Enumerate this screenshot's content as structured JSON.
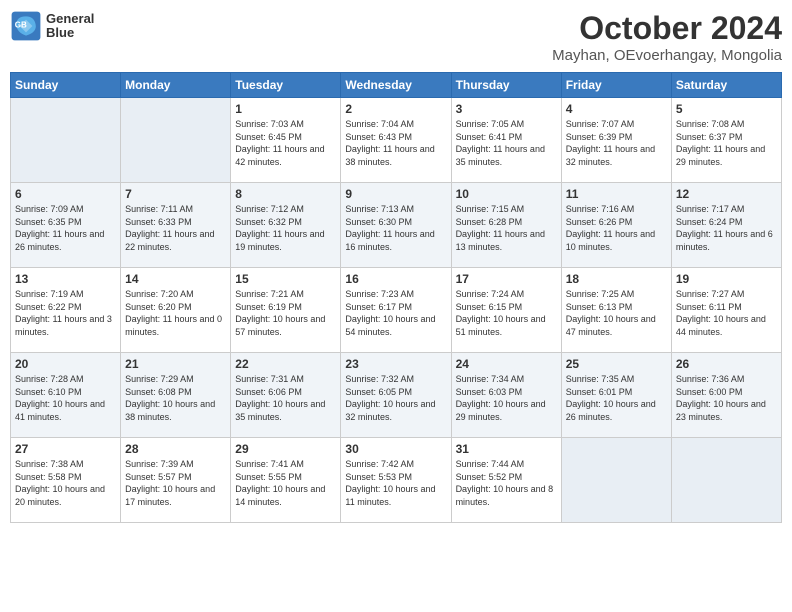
{
  "header": {
    "logo_line1": "General",
    "logo_line2": "Blue",
    "month": "October 2024",
    "location": "Mayhan, OEvoerhangay, Mongolia"
  },
  "weekdays": [
    "Sunday",
    "Monday",
    "Tuesday",
    "Wednesday",
    "Thursday",
    "Friday",
    "Saturday"
  ],
  "weeks": [
    [
      {
        "day": "",
        "empty": true
      },
      {
        "day": "",
        "empty": true
      },
      {
        "day": "1",
        "sunrise": "Sunrise: 7:03 AM",
        "sunset": "Sunset: 6:45 PM",
        "daylight": "Daylight: 11 hours and 42 minutes."
      },
      {
        "day": "2",
        "sunrise": "Sunrise: 7:04 AM",
        "sunset": "Sunset: 6:43 PM",
        "daylight": "Daylight: 11 hours and 38 minutes."
      },
      {
        "day": "3",
        "sunrise": "Sunrise: 7:05 AM",
        "sunset": "Sunset: 6:41 PM",
        "daylight": "Daylight: 11 hours and 35 minutes."
      },
      {
        "day": "4",
        "sunrise": "Sunrise: 7:07 AM",
        "sunset": "Sunset: 6:39 PM",
        "daylight": "Daylight: 11 hours and 32 minutes."
      },
      {
        "day": "5",
        "sunrise": "Sunrise: 7:08 AM",
        "sunset": "Sunset: 6:37 PM",
        "daylight": "Daylight: 11 hours and 29 minutes."
      }
    ],
    [
      {
        "day": "6",
        "sunrise": "Sunrise: 7:09 AM",
        "sunset": "Sunset: 6:35 PM",
        "daylight": "Daylight: 11 hours and 26 minutes."
      },
      {
        "day": "7",
        "sunrise": "Sunrise: 7:11 AM",
        "sunset": "Sunset: 6:33 PM",
        "daylight": "Daylight: 11 hours and 22 minutes."
      },
      {
        "day": "8",
        "sunrise": "Sunrise: 7:12 AM",
        "sunset": "Sunset: 6:32 PM",
        "daylight": "Daylight: 11 hours and 19 minutes."
      },
      {
        "day": "9",
        "sunrise": "Sunrise: 7:13 AM",
        "sunset": "Sunset: 6:30 PM",
        "daylight": "Daylight: 11 hours and 16 minutes."
      },
      {
        "day": "10",
        "sunrise": "Sunrise: 7:15 AM",
        "sunset": "Sunset: 6:28 PM",
        "daylight": "Daylight: 11 hours and 13 minutes."
      },
      {
        "day": "11",
        "sunrise": "Sunrise: 7:16 AM",
        "sunset": "Sunset: 6:26 PM",
        "daylight": "Daylight: 11 hours and 10 minutes."
      },
      {
        "day": "12",
        "sunrise": "Sunrise: 7:17 AM",
        "sunset": "Sunset: 6:24 PM",
        "daylight": "Daylight: 11 hours and 6 minutes."
      }
    ],
    [
      {
        "day": "13",
        "sunrise": "Sunrise: 7:19 AM",
        "sunset": "Sunset: 6:22 PM",
        "daylight": "Daylight: 11 hours and 3 minutes."
      },
      {
        "day": "14",
        "sunrise": "Sunrise: 7:20 AM",
        "sunset": "Sunset: 6:20 PM",
        "daylight": "Daylight: 11 hours and 0 minutes."
      },
      {
        "day": "15",
        "sunrise": "Sunrise: 7:21 AM",
        "sunset": "Sunset: 6:19 PM",
        "daylight": "Daylight: 10 hours and 57 minutes."
      },
      {
        "day": "16",
        "sunrise": "Sunrise: 7:23 AM",
        "sunset": "Sunset: 6:17 PM",
        "daylight": "Daylight: 10 hours and 54 minutes."
      },
      {
        "day": "17",
        "sunrise": "Sunrise: 7:24 AM",
        "sunset": "Sunset: 6:15 PM",
        "daylight": "Daylight: 10 hours and 51 minutes."
      },
      {
        "day": "18",
        "sunrise": "Sunrise: 7:25 AM",
        "sunset": "Sunset: 6:13 PM",
        "daylight": "Daylight: 10 hours and 47 minutes."
      },
      {
        "day": "19",
        "sunrise": "Sunrise: 7:27 AM",
        "sunset": "Sunset: 6:11 PM",
        "daylight": "Daylight: 10 hours and 44 minutes."
      }
    ],
    [
      {
        "day": "20",
        "sunrise": "Sunrise: 7:28 AM",
        "sunset": "Sunset: 6:10 PM",
        "daylight": "Daylight: 10 hours and 41 minutes."
      },
      {
        "day": "21",
        "sunrise": "Sunrise: 7:29 AM",
        "sunset": "Sunset: 6:08 PM",
        "daylight": "Daylight: 10 hours and 38 minutes."
      },
      {
        "day": "22",
        "sunrise": "Sunrise: 7:31 AM",
        "sunset": "Sunset: 6:06 PM",
        "daylight": "Daylight: 10 hours and 35 minutes."
      },
      {
        "day": "23",
        "sunrise": "Sunrise: 7:32 AM",
        "sunset": "Sunset: 6:05 PM",
        "daylight": "Daylight: 10 hours and 32 minutes."
      },
      {
        "day": "24",
        "sunrise": "Sunrise: 7:34 AM",
        "sunset": "Sunset: 6:03 PM",
        "daylight": "Daylight: 10 hours and 29 minutes."
      },
      {
        "day": "25",
        "sunrise": "Sunrise: 7:35 AM",
        "sunset": "Sunset: 6:01 PM",
        "daylight": "Daylight: 10 hours and 26 minutes."
      },
      {
        "day": "26",
        "sunrise": "Sunrise: 7:36 AM",
        "sunset": "Sunset: 6:00 PM",
        "daylight": "Daylight: 10 hours and 23 minutes."
      }
    ],
    [
      {
        "day": "27",
        "sunrise": "Sunrise: 7:38 AM",
        "sunset": "Sunset: 5:58 PM",
        "daylight": "Daylight: 10 hours and 20 minutes."
      },
      {
        "day": "28",
        "sunrise": "Sunrise: 7:39 AM",
        "sunset": "Sunset: 5:57 PM",
        "daylight": "Daylight: 10 hours and 17 minutes."
      },
      {
        "day": "29",
        "sunrise": "Sunrise: 7:41 AM",
        "sunset": "Sunset: 5:55 PM",
        "daylight": "Daylight: 10 hours and 14 minutes."
      },
      {
        "day": "30",
        "sunrise": "Sunrise: 7:42 AM",
        "sunset": "Sunset: 5:53 PM",
        "daylight": "Daylight: 10 hours and 11 minutes."
      },
      {
        "day": "31",
        "sunrise": "Sunrise: 7:44 AM",
        "sunset": "Sunset: 5:52 PM",
        "daylight": "Daylight: 10 hours and 8 minutes."
      },
      {
        "day": "",
        "empty": true
      },
      {
        "day": "",
        "empty": true
      }
    ]
  ]
}
